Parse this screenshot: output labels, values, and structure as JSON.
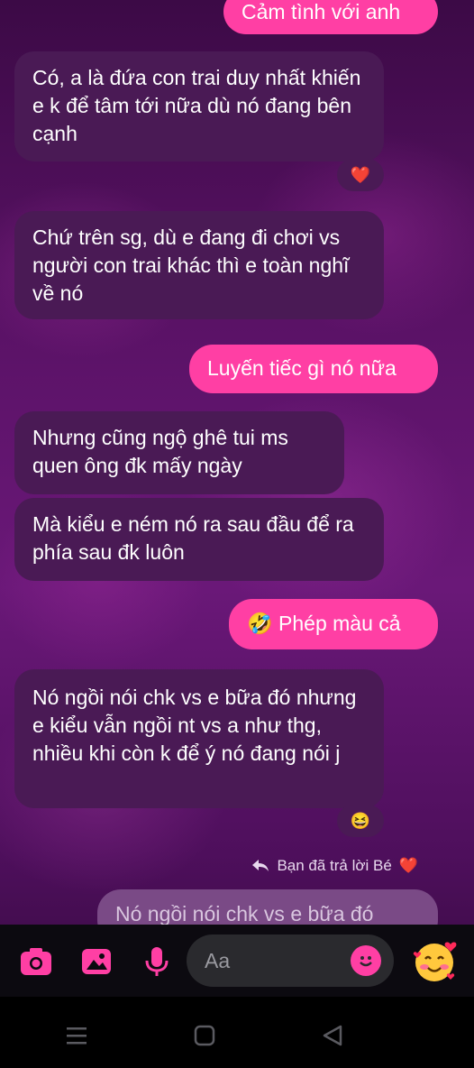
{
  "messages": [
    {
      "dir": "out",
      "text": "Cảm tình với anh"
    },
    {
      "dir": "in",
      "text": "Có, a là đứa con trai duy nhất khiến e k để tâm tới  nữa dù nó đang bên cạnh"
    },
    {
      "dir": "in",
      "text": "Chứ trên sg, dù e đang đi chơi vs người  con trai khác thì e toàn nghĩ về nó"
    },
    {
      "dir": "out",
      "text": "Luyến tiếc gì nó nữa"
    },
    {
      "dir": "in",
      "text": "Nhưng cũng ngộ ghê tui ms quen ông đk mấy ngày"
    },
    {
      "dir": "in",
      "text": "Mà kiểu e ném nó ra sau đầu để ra phía sau đk luôn"
    },
    {
      "dir": "out",
      "text": "🤣 Phép màu cả"
    },
    {
      "dir": "in",
      "text": "Nó ngồi nói chk vs e bữa đó nhưng e kiểu vẫn ngồi nt vs a như thg, nhiều khi còn k để ý nó đang nói j"
    }
  ],
  "reactions": {
    "msg2": {
      "icon": "heart-icon",
      "emoji": "❤️"
    },
    "msg8": {
      "icon": "laughing-face-icon",
      "emoji": "😆"
    }
  },
  "reply": {
    "note": "Bạn đã trả lời Bé",
    "note_emoji": "❤️",
    "quoted_text": "Nó ngồi nói chk vs e bữa đó"
  },
  "composer": {
    "placeholder": "Aa",
    "like_emoji": "🥰",
    "accent": "#ff3fa4"
  },
  "colors": {
    "incoming_bubble": "#4a1a55",
    "outgoing_bubble": "#ff3fa4"
  }
}
